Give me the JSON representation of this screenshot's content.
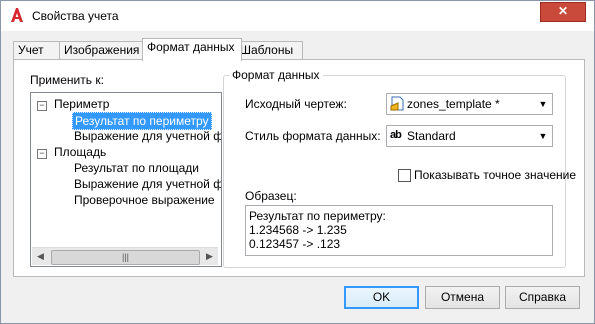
{
  "window": {
    "title": "Свойства учета",
    "close_label": "✕"
  },
  "tabs": [
    {
      "label": "Учет",
      "active": false
    },
    {
      "label": "Изображения",
      "active": false
    },
    {
      "label": "Формат данных",
      "active": true
    },
    {
      "label": "Шаблоны",
      "active": false
    }
  ],
  "apply_to": {
    "label": "Применить к:",
    "tree": [
      {
        "label": "Периметр",
        "expanded": true,
        "children": [
          {
            "label": "Результат по периметру",
            "selected": true
          },
          {
            "label": "Выражение для учетной ф"
          }
        ]
      },
      {
        "label": "Площадь",
        "expanded": true,
        "children": [
          {
            "label": "Результат по площади"
          },
          {
            "label": "Выражение для учетной ф"
          },
          {
            "label": "Проверочное выражение"
          }
        ]
      }
    ],
    "scroll_thumb_label": "|||"
  },
  "data_format": {
    "group_title": "Формат данных",
    "source_drawing_label": "Исходный чертеж:",
    "source_drawing_value": "zones_template *",
    "style_label": "Стиль формата данных:",
    "style_value": "Standard",
    "style_icon_text": "ab",
    "show_exact_label": "Показывать точное значение",
    "show_exact_checked": false,
    "sample_label": "Образец:",
    "sample_lines": [
      "Результат по периметру:",
      "1.234568 -> 1.235",
      "0.123457 -> .123"
    ]
  },
  "buttons": {
    "ok": "OK",
    "cancel": "Отмена",
    "help": "Справка"
  }
}
